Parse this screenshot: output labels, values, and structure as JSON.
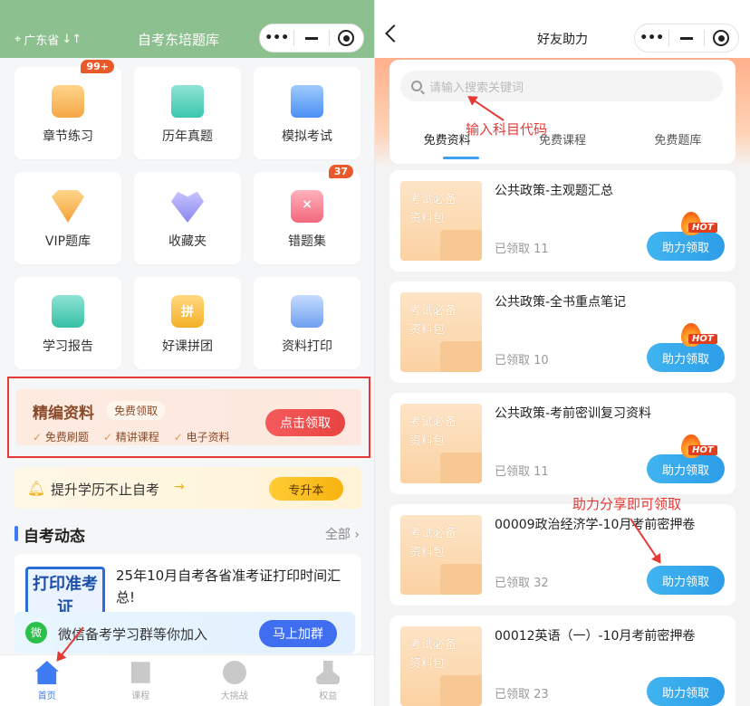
{
  "left": {
    "header": {
      "location": "广东省",
      "swap_icon": "swap-arrows-icon",
      "title": "自考东培题库"
    },
    "capsule": {
      "more": "•••"
    },
    "grid": [
      {
        "label": "章节练习",
        "icon": "book-icon",
        "glyph": "",
        "badge": "99+"
      },
      {
        "label": "历年真题",
        "icon": "exam-search-icon",
        "glyph": "",
        "badge": ""
      },
      {
        "label": "模拟考试",
        "icon": "document-icon",
        "glyph": "",
        "badge": ""
      },
      {
        "label": "VIP题库",
        "icon": "diamond-icon",
        "glyph": "",
        "badge": ""
      },
      {
        "label": "收藏夹",
        "icon": "heart-star-icon",
        "glyph": "",
        "badge": ""
      },
      {
        "label": "错题集",
        "icon": "wrong-book-icon",
        "glyph": "×",
        "badge": "37"
      },
      {
        "label": "学习报告",
        "icon": "report-icon",
        "glyph": "",
        "badge": ""
      },
      {
        "label": "好课拼团",
        "icon": "group-buy-icon",
        "glyph": "拼",
        "badge": ""
      },
      {
        "label": "资料打印",
        "icon": "printer-icon",
        "glyph": "",
        "badge": ""
      }
    ],
    "promo": {
      "title": "精编资料",
      "tag": "免费领取",
      "features": [
        "免费刷题",
        "精讲课程",
        "电子资料"
      ],
      "button": "点击领取"
    },
    "edu_banner": {
      "text": "提升学历不止自考",
      "arrow": "→",
      "button": "专升本"
    },
    "section": {
      "title": "自考动态",
      "more": "全部 ›"
    },
    "news": {
      "thumb_text": "打印准考证",
      "title": "25年10月自考各省准考证打印时间汇总!"
    },
    "wechat": {
      "icon_text": "微",
      "text": "微信备考学习群等你加入",
      "button": "马上加群"
    },
    "tabbar": [
      {
        "label": "首页",
        "icon": "home-icon",
        "active": true
      },
      {
        "label": "课程",
        "icon": "course-book-icon",
        "active": false
      },
      {
        "label": "大挑战",
        "icon": "compass-icon",
        "active": false
      },
      {
        "label": "权益",
        "icon": "user-icon",
        "active": false
      }
    ]
  },
  "right": {
    "header": {
      "title": "好友助力"
    },
    "capsule": {
      "more": "•••"
    },
    "search": {
      "placeholder": "请输入搜索关键词"
    },
    "annotations": {
      "search_hint": "输入科目代码",
      "share_hint": "助力分享即可领取"
    },
    "tabs": [
      {
        "label": "免费资料",
        "active": true
      },
      {
        "label": "免费课程",
        "active": false
      },
      {
        "label": "免费题库",
        "active": false
      }
    ],
    "items": [
      {
        "thumb": [
          "考试必备",
          "资料包"
        ],
        "name": "公共政策-主观题汇总",
        "claimed": "已领取 11",
        "button": "助力领取",
        "hot": "HOT"
      },
      {
        "thumb": [
          "考试必备",
          "资料包"
        ],
        "name": "公共政策-全书重点笔记",
        "claimed": "已领取 10",
        "button": "助力领取",
        "hot": "HOT"
      },
      {
        "thumb": [
          "考试必备",
          "资料包"
        ],
        "name": "公共政策-考前密训复习资料",
        "claimed": "已领取 11",
        "button": "助力领取",
        "hot": "HOT"
      },
      {
        "thumb": [
          "考试必备",
          "资料包"
        ],
        "name": "00009政治经济学-10月考前密押卷",
        "claimed": "已领取 32",
        "button": "助力领取",
        "hot": ""
      },
      {
        "thumb": [
          "考试必备",
          "资料包"
        ],
        "name": "00012英语（一）-10月考前密押卷",
        "claimed": "已领取 23",
        "button": "助力领取",
        "hot": ""
      }
    ]
  }
}
